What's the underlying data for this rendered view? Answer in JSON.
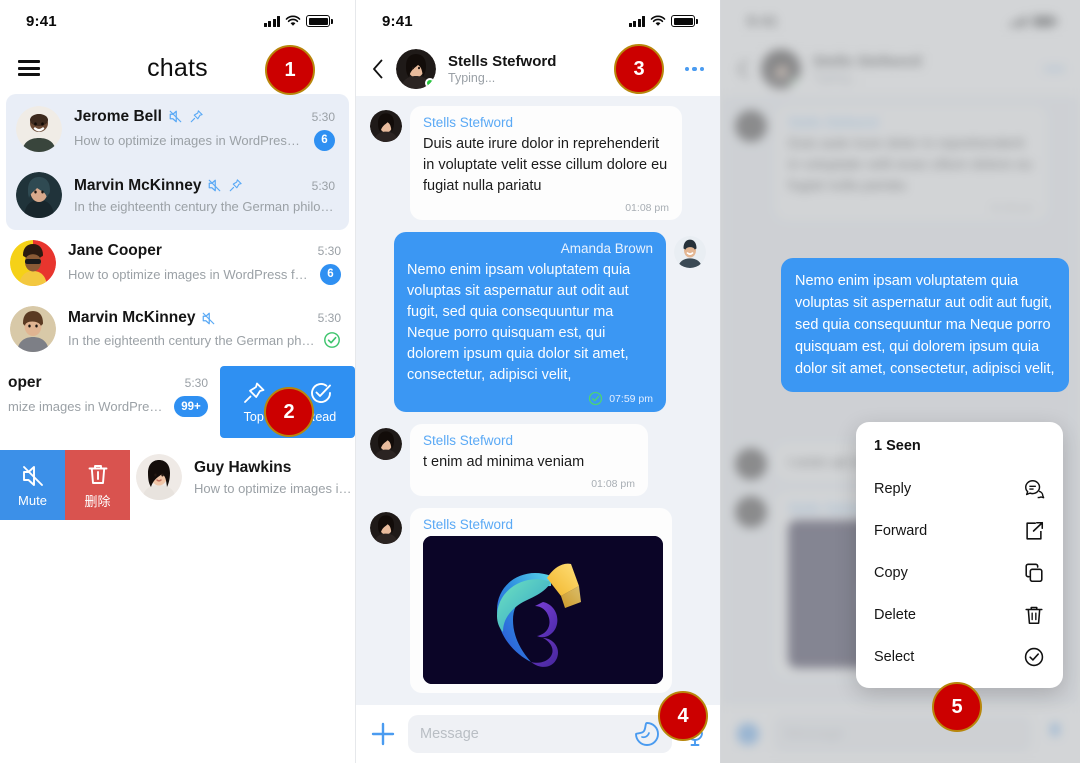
{
  "status_bar": {
    "time": "9:41"
  },
  "colors": {
    "accent_blue": "#2f90f2",
    "bubble_blue": "#3b97f3",
    "badge_red": "#cc0000",
    "badge_border": "#b8860b",
    "delete_red": "#d9534f",
    "online_green": "#27c840",
    "list_highlight": "#e9eef7",
    "thread_bg": "#eff2f7"
  },
  "chats_panel": {
    "menu_icon": "hamburger-icon",
    "title": "chats",
    "rows": [
      {
        "name": "Jerome Bell",
        "preview": "How to optimize images in WordPress for...",
        "time": "5:30",
        "unread": "6",
        "muted": true,
        "pinned": true,
        "highlighted": true
      },
      {
        "name": "Marvin McKinney",
        "preview": "In the eighteenth century the German philosoph...",
        "time": "5:30",
        "unread": "",
        "muted": true,
        "pinned": true,
        "highlighted": true
      },
      {
        "name": "Jane Cooper",
        "preview": "How to optimize images in WordPress for...",
        "time": "5:30",
        "unread": "6",
        "muted": false,
        "pinned": false,
        "highlighted": false
      },
      {
        "name": "Marvin McKinney",
        "preview": "In the eighteenth century the German philos...",
        "time": "5:30",
        "unread": "",
        "read_check": true,
        "muted": true,
        "pinned": false,
        "highlighted": false
      }
    ],
    "swiped_row": {
      "name_fragment": "oper",
      "preview_fragment": "mize images in WordPress...",
      "time": "5:30",
      "unread": "99+",
      "actions": [
        {
          "label": "Top",
          "icon": "pin-icon"
        },
        {
          "label": "Read",
          "icon": "check-circle-icon"
        }
      ]
    },
    "bottom_row": {
      "name": "Guy Hawkins",
      "preview": "How to optimize images in W",
      "left_actions": [
        {
          "label": "Mute",
          "icon": "mute-icon"
        },
        {
          "label": "删除",
          "icon": "trash-icon"
        }
      ]
    }
  },
  "thread_panel": {
    "header": {
      "back_icon": "chevron-left-icon",
      "name": "Stells Stefword",
      "status": "Typing...",
      "more_icon": "more-horizontal-icon"
    },
    "messages": [
      {
        "side": "in",
        "sender": "Stells Stefword",
        "text": "Duis aute irure dolor in reprehenderit in voluptate velit esse cillum dolore eu fugiat nulla pariatu",
        "time": "01:08 pm"
      },
      {
        "side": "out",
        "sender": "Amanda Brown",
        "text": "Nemo enim ipsam voluptatem quia voluptas sit aspernatur aut odit aut fugit, sed quia consequuntur ma Neque porro quisquam est, qui dolorem ipsum quia dolor sit amet, consectetur, adipisci velit,",
        "time": "07:59 pm",
        "read_check": true
      },
      {
        "side": "in",
        "sender": "Stells Stefword",
        "text": "t enim ad minima veniam",
        "time": "01:08 pm"
      },
      {
        "side": "in",
        "sender": "Stells Stefword",
        "type": "photo",
        "photo_alt": "chameleon-logo-image"
      }
    ],
    "input_bar": {
      "add_icon": "plus-icon",
      "placeholder": "Message",
      "sticker_icon": "sticker-icon",
      "mic_icon": "microphone-icon"
    }
  },
  "menu_panel": {
    "focused_message": {
      "text": "Nemo enim ipsam voluptatem quia voluptas sit aspernatur aut odit aut fugit, sed quia consequuntur ma Neque porro quisquam est, qui dolorem ipsum quia dolor sit amet, consectetur, adipisci velit,"
    },
    "context_menu": {
      "seen_label": "1 Seen",
      "items": [
        {
          "label": "Reply",
          "icon": "reply-bubble-icon"
        },
        {
          "label": "Forward",
          "icon": "forward-icon"
        },
        {
          "label": "Copy",
          "icon": "copy-icon"
        },
        {
          "label": "Delete",
          "icon": "trash-icon"
        },
        {
          "label": "Select",
          "icon": "check-circle-icon"
        }
      ]
    }
  },
  "steps": [
    {
      "n": "1"
    },
    {
      "n": "2"
    },
    {
      "n": "3"
    },
    {
      "n": "4"
    },
    {
      "n": "5"
    }
  ]
}
